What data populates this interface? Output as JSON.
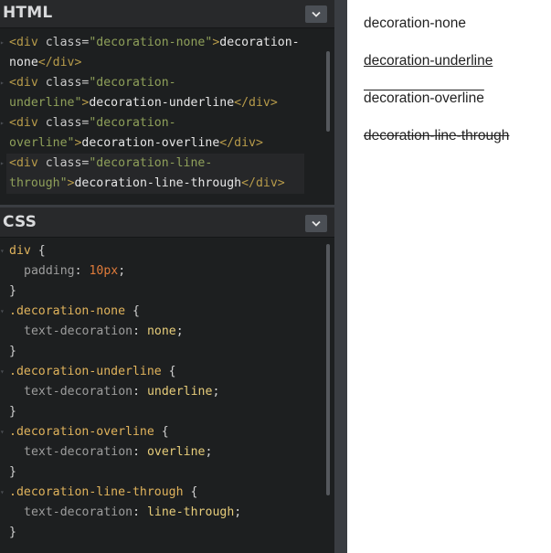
{
  "html_panel": {
    "title": "HTML",
    "toggle_icon": "chevron-down-icon",
    "lines": [
      {
        "tag_open": "<div ",
        "attr": "class=",
        "val": "\"decoration-none\"",
        "close": ">",
        "text": "decoration-",
        "end": ""
      },
      {
        "text": "none",
        "end": "</div>"
      },
      {
        "tag_open": "<div ",
        "attr": "class=",
        "val": "\"decoration-",
        "close": "",
        "text": "",
        "end": ""
      },
      {
        "val": "underline\"",
        "close": ">",
        "text": "decoration-underline",
        "end": "</div>"
      },
      {
        "tag_open": "<div ",
        "attr": "class=",
        "val": "\"decoration-",
        "close": "",
        "text": "",
        "end": ""
      },
      {
        "val": "overline\"",
        "close": ">",
        "text": "decoration-overline",
        "end": "</div>"
      },
      {
        "tag_open": "<div ",
        "attr": "class=",
        "val": "\"decoration-line-",
        "close": "",
        "text": "",
        "end": ""
      },
      {
        "val": "through\"",
        "close": ">",
        "text": "decoration-line-through",
        "end": "</div>"
      }
    ]
  },
  "css_panel": {
    "title": "CSS",
    "toggle_icon": "chevron-down-icon",
    "lines": [
      {
        "sel": "div",
        "punc": " {"
      },
      {
        "prop": "padding",
        "colon": ": ",
        "value": "10px",
        "semi": ";"
      },
      {
        "punc": "}"
      },
      {
        "sel": ".decoration-none",
        "punc": " {"
      },
      {
        "prop": "text-decoration",
        "colon": ": ",
        "value": "none",
        "semi": ";"
      },
      {
        "punc": "}"
      },
      {
        "sel": ".decoration-underline",
        "punc": " {"
      },
      {
        "prop": "text-decoration",
        "colon": ": ",
        "value": "underline",
        "semi": ";"
      },
      {
        "punc": "}"
      },
      {
        "sel": ".decoration-overline",
        "punc": " {"
      },
      {
        "prop": "text-decoration",
        "colon": ": ",
        "value": "overline",
        "semi": ";"
      },
      {
        "punc": "}"
      },
      {
        "sel": ".decoration-line-through",
        "punc": " {"
      },
      {
        "prop": "text-decoration",
        "colon": ": ",
        "value": "line-through",
        "semi": ";"
      },
      {
        "punc": "}"
      }
    ]
  },
  "preview": {
    "items": [
      {
        "text": "decoration-none"
      },
      {
        "text": "decoration-underline"
      },
      {
        "text": "decoration-overline"
      },
      {
        "text": "decoration-line-through"
      }
    ]
  },
  "colors": {
    "editor_bg": "#1d1f20",
    "header_bg": "#28292b",
    "tag": "#b79b4a",
    "string": "#8fa05a",
    "selector": "#e0b35c",
    "number": "#e07b3a"
  }
}
